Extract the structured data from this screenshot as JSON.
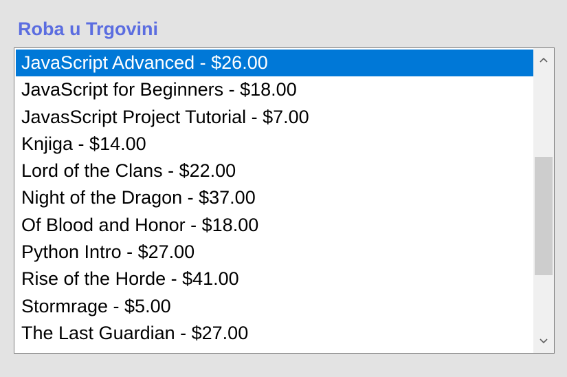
{
  "title": "Roba u Trgovini",
  "listbox": {
    "selected_index": 0,
    "items": [
      "JavaScript Advanced - $26.00",
      "JavaScript for Beginners - $18.00",
      "JavasScript Project Tutorial - $7.00",
      "Knjiga - $14.00",
      "Lord of the Clans - $22.00",
      "Night of the Dragon - $37.00",
      "Of Blood and Honor - $18.00",
      "Python Intro - $27.00",
      "Rise of the Horde - $41.00",
      "Stormrage - $5.00",
      "The Last Guardian - $27.00"
    ]
  },
  "scrollbar": {
    "up_icon": "chevron-up-icon",
    "down_icon": "chevron-down-icon"
  },
  "colors": {
    "title": "#5b6de0",
    "selection_background": "#0078d7",
    "selection_text": "#ffffff",
    "page_background": "#e3e3e3",
    "scroll_thumb": "#cdcdcd"
  }
}
